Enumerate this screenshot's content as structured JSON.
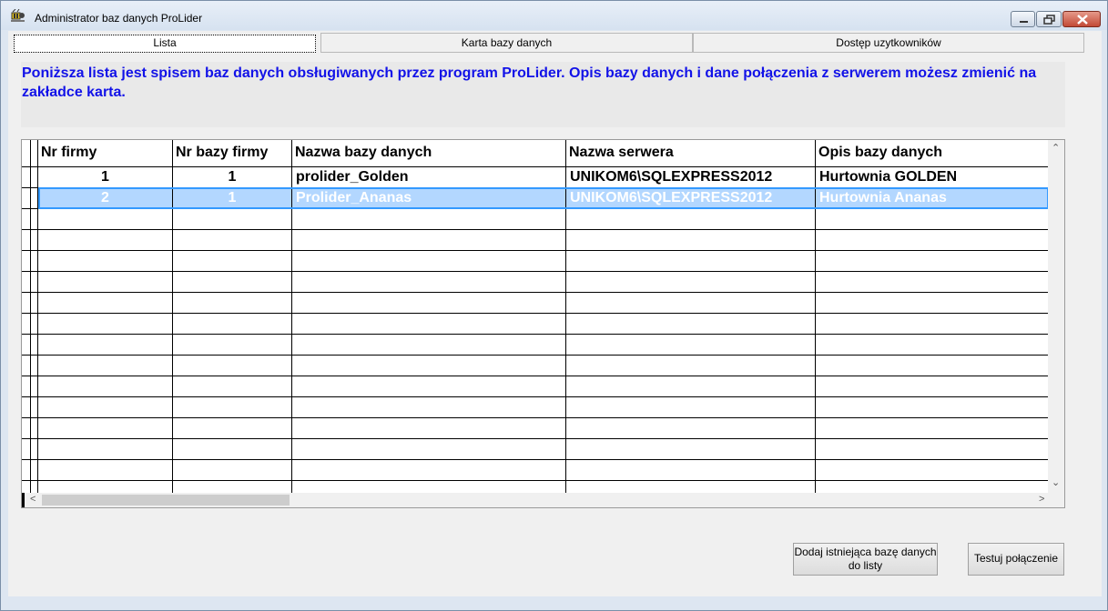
{
  "window": {
    "title": "Administrator baz danych ProLider",
    "icon": "app-bee-icon"
  },
  "tabs": [
    {
      "label": "Lista",
      "active": true
    },
    {
      "label": "Karta bazy danych",
      "active": false
    },
    {
      "label": "Dostęp uzytkowników",
      "active": false
    }
  ],
  "info": {
    "text": "Poniższa lista jest spisem baz danych obsługiwanych przez program ProLider. Opis bazy danych i dane połączenia z serwerem możesz zmienić na zakładce karta.",
    "color": "#1212e8"
  },
  "grid": {
    "columns": [
      "Nr  firmy",
      "Nr  bazy  firmy",
      "Nazwa bazy danych",
      "Nazwa serwera",
      "Opis bazy danych"
    ],
    "rows": [
      {
        "nr_firmy": "1",
        "nr_bazy": "1",
        "nazwa": "prolider_Golden",
        "serwer": "UNIKOM6\\SQLEXPRESS2012",
        "opis": "Hurtownia GOLDEN",
        "selected": false
      },
      {
        "nr_firmy": "2",
        "nr_bazy": "1",
        "nazwa": "Prolider_Ananas",
        "serwer": "UNIKOM6\\SQLEXPRESS2012",
        "opis": "Hurtownia Ananas",
        "selected": true
      }
    ],
    "empty_rows": 14,
    "selection_color": "#b3d7ff"
  },
  "buttons": {
    "add_existing": "Dodaj istniejąca bazę danych do listy",
    "test_connection": "Testuj połączenie"
  }
}
